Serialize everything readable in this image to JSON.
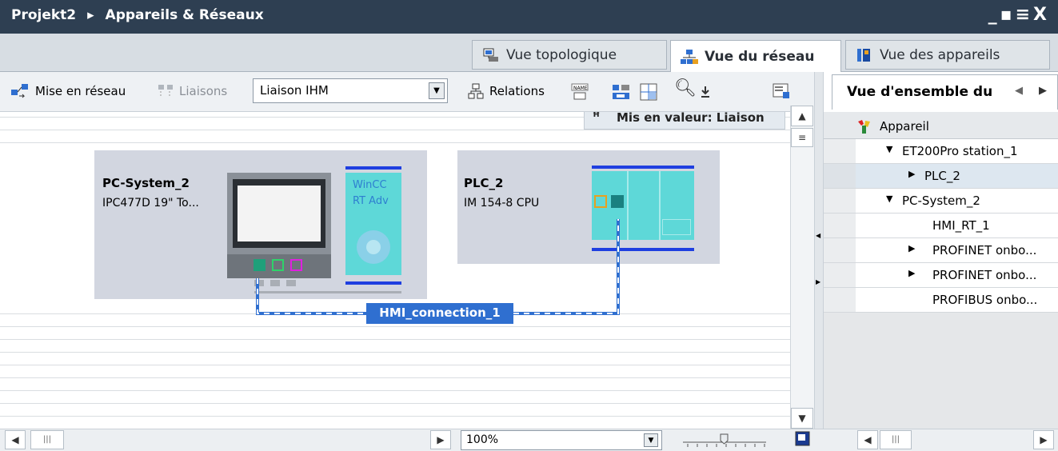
{
  "title": {
    "project": "Projekt2",
    "separator": "▸",
    "section": "Appareils & Réseaux"
  },
  "window_buttons": [
    "_",
    "▪",
    "≡",
    "X"
  ],
  "view_tabs": [
    {
      "label": "Vue topologique",
      "active": false
    },
    {
      "label": "Vue du réseau",
      "active": true
    },
    {
      "label": "Vue des appareils",
      "active": false
    }
  ],
  "toolbar": {
    "network_label": "Mise en réseau",
    "connections_label": "Liaisons",
    "connection_type": "Liaison IHM",
    "relations_label": "Relations"
  },
  "highlight_bar": "Mis en valeur: Liaison",
  "devices": {
    "pc": {
      "name": "PC-System_2",
      "type": "IPC477D 19\" To...",
      "software_line1": "WinCC",
      "software_line2": "RT Adv"
    },
    "plc": {
      "name": "PLC_2",
      "type": "IM 154-8 CPU"
    }
  },
  "connection_label": "HMI_connection_1",
  "zoom": {
    "value": "100%"
  },
  "overview": {
    "tab_title": "Vue d'ensemble du",
    "column_header": "Appareil",
    "rows": [
      {
        "label": "ET200Pro station_1",
        "arrow": "▼"
      },
      {
        "label": "PLC_2",
        "arrow": "▶"
      },
      {
        "label": "PC-System_2",
        "arrow": "▼"
      },
      {
        "label": "HMI_RT_1",
        "arrow": ""
      },
      {
        "label": "PROFINET onbo...",
        "arrow": "▶"
      },
      {
        "label": "PROFINET onbo...",
        "arrow": "▶"
      },
      {
        "label": "PROFIBUS onbo...",
        "arrow": ""
      }
    ]
  },
  "colors": {
    "accent": "#2f6fd0",
    "device_bg": "#d2d6e0",
    "titlebar": "#2e3f52",
    "hmi_cyan": "#5ed8d8",
    "bus_blue": "#1f3fe0"
  }
}
